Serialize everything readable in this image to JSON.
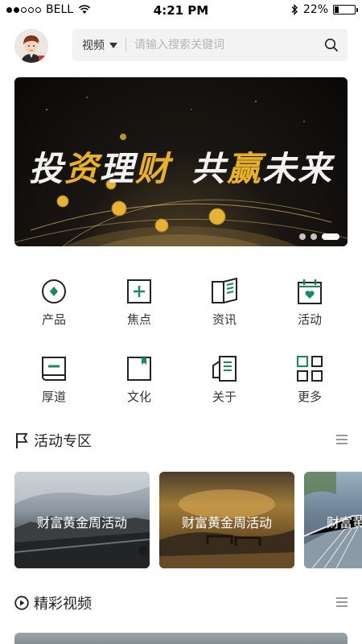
{
  "status_bar": {
    "carrier": "BELL",
    "time": "4:21 PM",
    "battery_percent": "22%",
    "battery_level": 0.22
  },
  "header": {
    "search_type": "视频",
    "search_placeholder": "请输入搜索关键词"
  },
  "banner": {
    "title_white_1": "投",
    "title_gold_1": "资",
    "title_white_2": "理",
    "title_gold_2": "财",
    "title_white_3": "共",
    "title_gold_3": "赢",
    "title_white_4": "未来",
    "page_count": 3,
    "active_page": 3
  },
  "grid": {
    "row1": [
      {
        "label": "产品",
        "icon": "product-icon"
      },
      {
        "label": "焦点",
        "icon": "focus-icon"
      },
      {
        "label": "资讯",
        "icon": "news-icon"
      },
      {
        "label": "活动",
        "icon": "activity-icon"
      }
    ],
    "row2": [
      {
        "label": "厚道",
        "icon": "integrity-icon"
      },
      {
        "label": "文化",
        "icon": "culture-icon"
      },
      {
        "label": "关于",
        "icon": "about-icon"
      },
      {
        "label": "更多",
        "icon": "more-icon"
      }
    ]
  },
  "sections": {
    "activities_title": "活动专区",
    "videos_title": "精彩视频"
  },
  "activity_cards": [
    {
      "label": "财富黄金周活动"
    },
    {
      "label": "财富黄金周活动"
    },
    {
      "label": "财富黄金周活动"
    }
  ],
  "colors": {
    "accent_green": "#1a8a5a",
    "banner_gold": "#e8b12a"
  }
}
